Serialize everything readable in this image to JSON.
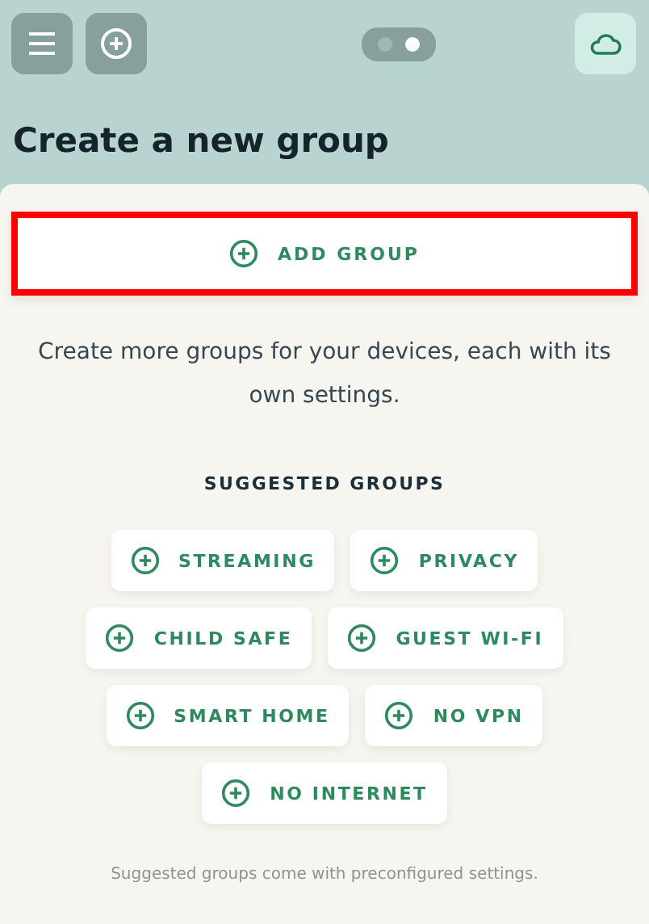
{
  "top_bar": {
    "page_dots": [
      {
        "selected": false
      },
      {
        "selected": true
      }
    ]
  },
  "title": "Create a new group",
  "add_button": {
    "label": "ADD GROUP",
    "highlighted": true
  },
  "description": "Create more groups for your devices, each with its own settings.",
  "suggested": {
    "heading": "SUGGESTED GROUPS",
    "rows": [
      [
        "STREAMING",
        "PRIVACY"
      ],
      [
        "CHILD SAFE",
        "GUEST WI-FI"
      ],
      [
        "SMART HOME",
        "NO VPN"
      ],
      [
        "NO INTERNET"
      ]
    ],
    "note": "Suggested groups come with preconfigured settings."
  }
}
